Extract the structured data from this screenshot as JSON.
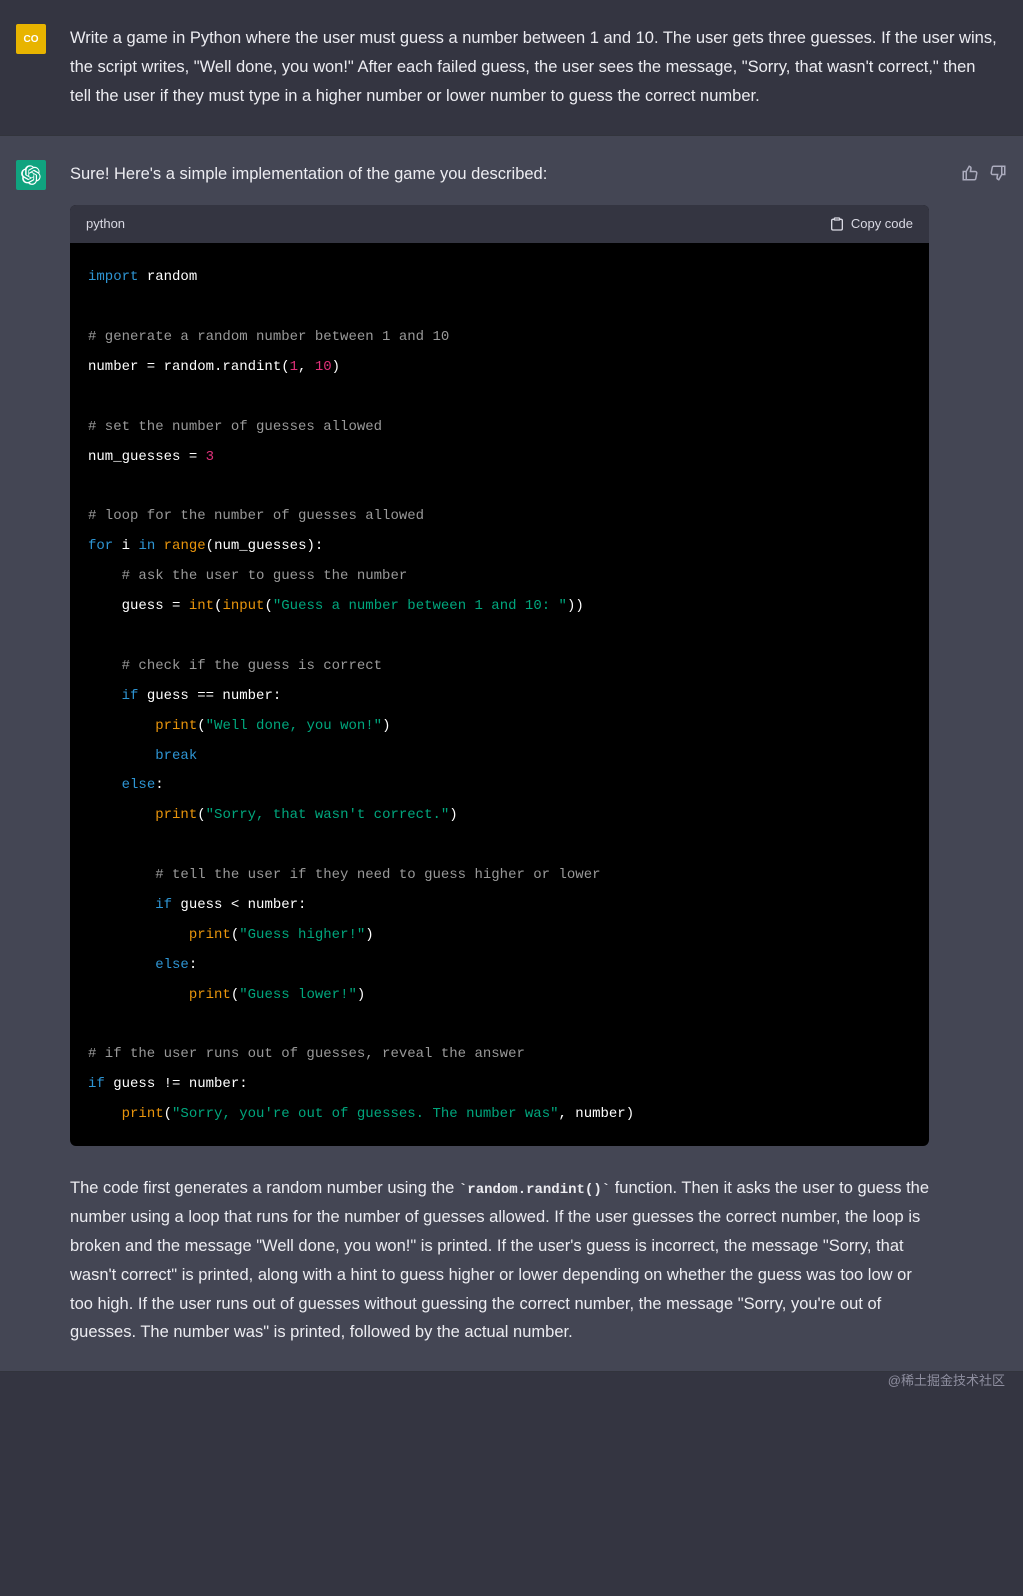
{
  "user": {
    "avatar_label": "CO",
    "prompt": "Write a game in Python where the user must guess a number between 1 and 10. The user gets three guesses. If the user wins, the script writes, \"Well done, you won!\" After each failed guess, the user sees the message, \"Sorry, that wasn't correct,\" then tell the user if they must type in a higher number or lower number to guess the correct number."
  },
  "assistant": {
    "intro": "Sure! Here's a simple implementation of the game you described:",
    "code_lang": "python",
    "copy_label": "Copy code",
    "code_tokens": [
      [
        [
          "kw",
          "import"
        ],
        [
          "op",
          " "
        ],
        [
          "mod",
          "random"
        ]
      ],
      [],
      [
        [
          "cmt",
          "# generate a random number between 1 and 10"
        ]
      ],
      [
        [
          "mod",
          "number = random.randint("
        ],
        [
          "num",
          "1"
        ],
        [
          "mod",
          ", "
        ],
        [
          "num",
          "10"
        ],
        [
          "mod",
          ")"
        ]
      ],
      [],
      [
        [
          "cmt",
          "# set the number of guesses allowed"
        ]
      ],
      [
        [
          "mod",
          "num_guesses = "
        ],
        [
          "num",
          "3"
        ]
      ],
      [],
      [
        [
          "cmt",
          "# loop for the number of guesses allowed"
        ]
      ],
      [
        [
          "kw",
          "for"
        ],
        [
          "mod",
          " i "
        ],
        [
          "kw",
          "in"
        ],
        [
          "mod",
          " "
        ],
        [
          "bi",
          "range"
        ],
        [
          "mod",
          "(num_guesses):"
        ]
      ],
      [
        [
          "mod",
          "    "
        ],
        [
          "cmt",
          "# ask the user to guess the number"
        ]
      ],
      [
        [
          "mod",
          "    guess = "
        ],
        [
          "bi",
          "int"
        ],
        [
          "mod",
          "("
        ],
        [
          "bi",
          "input"
        ],
        [
          "mod",
          "("
        ],
        [
          "str",
          "\"Guess a number between 1 and 10: \""
        ],
        [
          "mod",
          "))"
        ]
      ],
      [],
      [
        [
          "mod",
          "    "
        ],
        [
          "cmt",
          "# check if the guess is correct"
        ]
      ],
      [
        [
          "mod",
          "    "
        ],
        [
          "kw",
          "if"
        ],
        [
          "mod",
          " guess == number:"
        ]
      ],
      [
        [
          "mod",
          "        "
        ],
        [
          "bi",
          "print"
        ],
        [
          "mod",
          "("
        ],
        [
          "str",
          "\"Well done, you won!\""
        ],
        [
          "mod",
          ")"
        ]
      ],
      [
        [
          "mod",
          "        "
        ],
        [
          "kw",
          "break"
        ]
      ],
      [
        [
          "mod",
          "    "
        ],
        [
          "kw",
          "else"
        ],
        [
          "mod",
          ":"
        ]
      ],
      [
        [
          "mod",
          "        "
        ],
        [
          "bi",
          "print"
        ],
        [
          "mod",
          "("
        ],
        [
          "str",
          "\"Sorry, that wasn't correct.\""
        ],
        [
          "mod",
          ")"
        ]
      ],
      [],
      [
        [
          "mod",
          "        "
        ],
        [
          "cmt",
          "# tell the user if they need to guess higher or lower"
        ]
      ],
      [
        [
          "mod",
          "        "
        ],
        [
          "kw",
          "if"
        ],
        [
          "mod",
          " guess < number:"
        ]
      ],
      [
        [
          "mod",
          "            "
        ],
        [
          "bi",
          "print"
        ],
        [
          "mod",
          "("
        ],
        [
          "str",
          "\"Guess higher!\""
        ],
        [
          "mod",
          ")"
        ]
      ],
      [
        [
          "mod",
          "        "
        ],
        [
          "kw",
          "else"
        ],
        [
          "mod",
          ":"
        ]
      ],
      [
        [
          "mod",
          "            "
        ],
        [
          "bi",
          "print"
        ],
        [
          "mod",
          "("
        ],
        [
          "str",
          "\"Guess lower!\""
        ],
        [
          "mod",
          ")"
        ]
      ],
      [],
      [
        [
          "cmt",
          "# if the user runs out of guesses, reveal the answer"
        ]
      ],
      [
        [
          "kw",
          "if"
        ],
        [
          "mod",
          " guess != number:"
        ]
      ],
      [
        [
          "mod",
          "    "
        ],
        [
          "bi",
          "print"
        ],
        [
          "mod",
          "("
        ],
        [
          "str",
          "\"Sorry, you're out of guesses. The number was\""
        ],
        [
          "mod",
          ", number)"
        ]
      ]
    ],
    "explanation_pre": "The code first generates a random number using the ",
    "explanation_code": "`random.randint()`",
    "explanation_post": " function. Then it asks the user to guess the number using a loop that runs for the number of guesses allowed. If the user guesses the correct number, the loop is broken and the message \"Well done, you won!\" is printed. If the user's guess is incorrect, the message \"Sorry, that wasn't correct\" is printed, along with a hint to guess higher or lower depending on whether the guess was too low or too high. If the user runs out of guesses without guessing the correct number, the message \"Sorry, you're out of guesses. The number was\" is printed, followed by the actual number."
  },
  "watermark": "@稀土掘金技术社区"
}
